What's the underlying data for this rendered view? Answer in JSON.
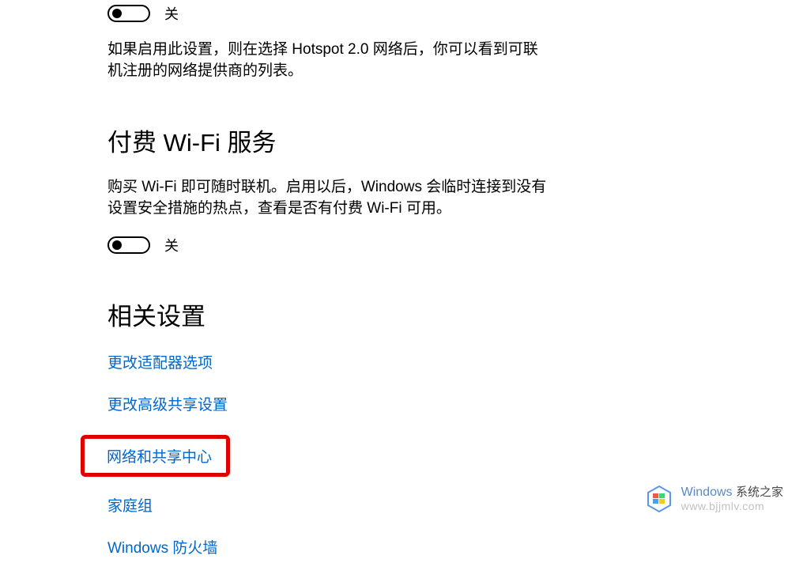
{
  "hotspot": {
    "toggle_state": "off",
    "toggle_label": "关",
    "description": "如果启用此设置，则在选择 Hotspot 2.0 网络后，你可以看到可联机注册的网络提供商的列表。"
  },
  "paidWifi": {
    "heading": "付费 Wi-Fi 服务",
    "description": "购买 Wi-Fi 即可随时联机。启用以后，Windows 会临时连接到没有设置安全措施的热点，查看是否有付费 Wi-Fi 可用。",
    "toggle_state": "off",
    "toggle_label": "关"
  },
  "related": {
    "heading": "相关设置",
    "links": {
      "adapter": "更改适配器选项",
      "sharing": "更改高级共享设置",
      "network_center": "网络和共享中心",
      "homegroup": "家庭组",
      "firewall": "Windows 防火墙"
    }
  },
  "watermark": {
    "brand_en": "Windows",
    "brand_cn": "系统之家",
    "url": "www.bjjmlv.com"
  }
}
